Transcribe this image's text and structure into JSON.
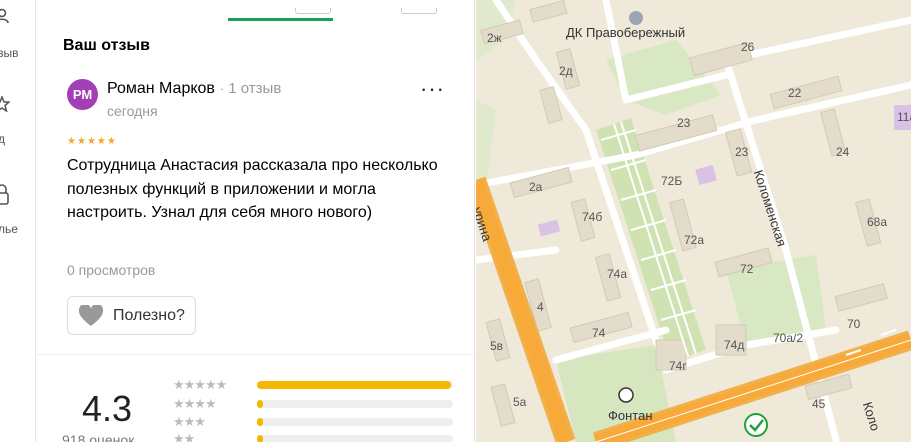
{
  "rail": {
    "items": [
      {
        "icon": "reviews-icon",
        "label": "зыв"
      },
      {
        "icon": "star-icon",
        "label": "д"
      },
      {
        "icon": "lock-icon",
        "label": "лье"
      }
    ]
  },
  "review_panel": {
    "section_title": "Ваш отзыв",
    "review": {
      "avatar_initials": "РМ",
      "author": "Роман Марков",
      "author_reviews": "1 отзыв",
      "date": "сегодня",
      "rating": 5,
      "text": "Сотрудница Анастасия рассказала про несколько полезных функций в приложении и могла настроить. Узнал для себя много нового)",
      "views": "0 просмотров",
      "helpful_label": "Полезно?"
    },
    "summary": {
      "rating": "4.3",
      "count_text": "918 оценок",
      "distribution": [
        {
          "stars": "★★★★★",
          "fraction": 0.99
        },
        {
          "stars": "★★★★",
          "fraction": 0.03
        },
        {
          "stars": "★★★",
          "fraction": 0.03
        },
        {
          "stars": "★★",
          "fraction": 0.03
        }
      ]
    }
  },
  "map": {
    "labels": {
      "dk": "ДК Правобережный",
      "fontan": "Фонтан",
      "kolomenskaya": "Коломенская",
      "kolomenskaya2": "Коло",
      "urina": "урина",
      "b2zh": "2ж",
      "b26": "26",
      "b2d": "2д",
      "b22": "22",
      "b23": "23",
      "b24": "24",
      "b23b": "23",
      "b11a": "11а",
      "b2a": "2а",
      "b72b": "72Б",
      "b74b": "74б",
      "b72a": "72а",
      "b68a": "68а",
      "b74a": "74а",
      "b72": "72",
      "b4": "4",
      "b70": "70",
      "b74": "74",
      "b74d": "74д",
      "b70a2": "70а/2",
      "b5v": "5в",
      "b74g": "74г",
      "b5a": "5а",
      "b45": "45"
    }
  }
}
